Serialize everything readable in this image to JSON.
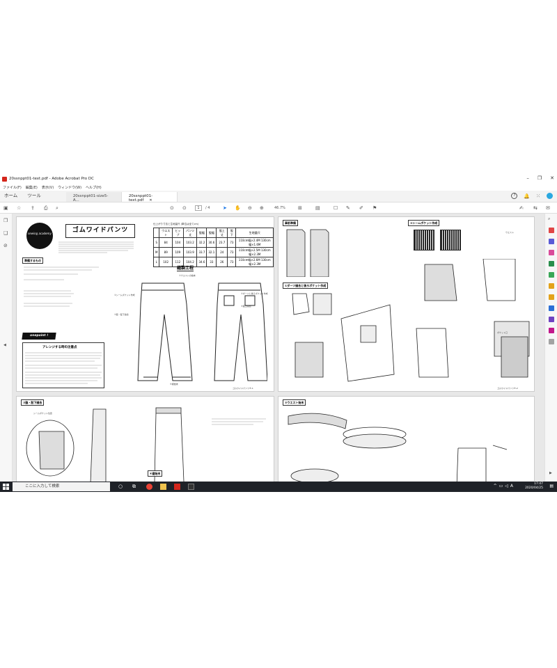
{
  "window": {
    "title": "20ssnppt01-text.pdf - Adobe Acrobat Pro DC",
    "menu": [
      "ファイル(F)",
      "編集(E)",
      "表示(V)",
      "ウィンドウ(W)",
      "ヘルプ(H)"
    ]
  },
  "tabs": {
    "home": "ホーム",
    "tools": "ツール",
    "documents": [
      {
        "label": "20ssnppt01-size5-A...",
        "active": false
      },
      {
        "label": "20ssnppt01-text.pdf",
        "active": true
      }
    ]
  },
  "toolbar": {
    "page_current": "1",
    "page_total": "/ 4",
    "zoom": "46.7%"
  },
  "pattern": {
    "title": "ゴムワイドパンツ",
    "badge": "sewing academy",
    "spec_caption": "仕上がり寸法と生地量尺 (単位は全てcm)",
    "spec_headers": [
      "",
      "ウエスト",
      "ヒップ",
      "パンツ丈",
      "股幅",
      "股幅",
      "股上丈",
      "股下",
      "生地量尺"
    ],
    "spec_rows": [
      [
        "S",
        "84",
        "104",
        "103.2",
        "32.2",
        "30.6",
        "23.7",
        "73",
        "110cm幅×2.4M 130cm幅×1.6M"
      ],
      [
        "M",
        "89",
        "109",
        "103.9",
        "33.7",
        "32.1",
        "24",
        "73",
        "110cm幅×2.5M 130cm幅×2.3M"
      ],
      [
        "L",
        "102",
        "112",
        "104.2",
        "34.6",
        "33",
        "26",
        "73",
        "110cm幅×2.6M 130cm幅×2.3M"
      ]
    ],
    "prep_label": "準備するもの",
    "process_title": "縫製工程",
    "steps": [
      "①ウエストの始末",
      "②シームポケット作成",
      "③脇・股下縫合",
      "④ダーツと後ろポケット作成",
      "⑤股上縫合",
      "⑥裾始末"
    ],
    "onepoint": "onepoint !",
    "arrange_title": "アレンジする時の注意点",
    "footer": "ゴムワイドパンツ⑥-1",
    "page2": {
      "prep": "事前準備",
      "dart": "①ダーツ縫合と後ろポケット作成",
      "seam_pocket": "②シームポケット作成",
      "footer": "ゴムワイドパンツ⑥-2",
      "waist_label": "ウエスト",
      "pocket_label": "ポケット口"
    },
    "page3": {
      "side": "③脇・股下縫合",
      "seam_label": "シームポケット位置",
      "hem": "④裾始末"
    },
    "page4": {
      "waist": "⑤ウエスト始末"
    }
  },
  "taskbar": {
    "search_placeholder": "ここに入力して検索",
    "time": "17:47",
    "date": "2020/04/25",
    "ime": "A"
  },
  "colors": {
    "acrobat_red": "#d4261c",
    "taskbar": "#1f2228"
  }
}
